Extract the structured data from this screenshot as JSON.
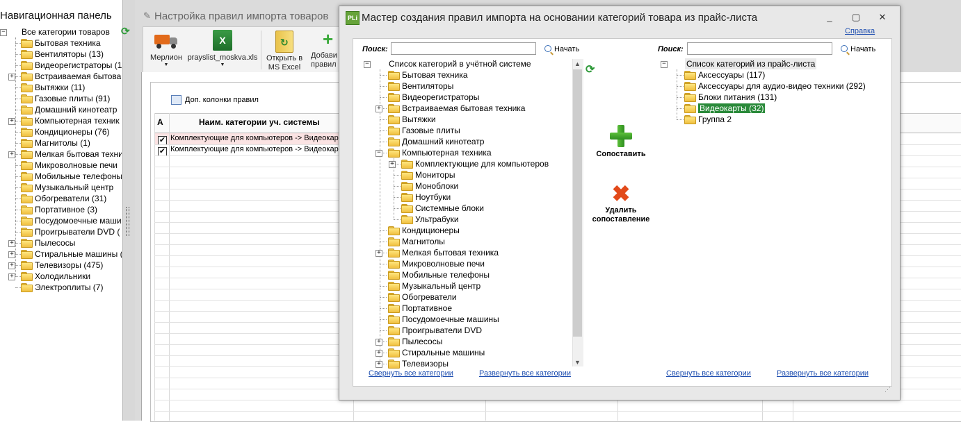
{
  "nav": {
    "title": "Навигационная панель",
    "root": "Все категории товаров",
    "items": [
      {
        "label": "Бытовая техника",
        "expandable": false
      },
      {
        "label": "Вентиляторы (13)",
        "expandable": false
      },
      {
        "label": "Видеорегистраторы (1",
        "expandable": false
      },
      {
        "label": "Встраиваемая бытова",
        "expandable": true
      },
      {
        "label": "Вытяжки (11)",
        "expandable": false
      },
      {
        "label": "Газовые плиты (91)",
        "expandable": false
      },
      {
        "label": "Домашний кинотеатр",
        "expandable": false
      },
      {
        "label": "Компьютерная техник",
        "expandable": true
      },
      {
        "label": "Кондиционеры (76)",
        "expandable": false
      },
      {
        "label": "Магнитолы (1)",
        "expandable": false
      },
      {
        "label": "Мелкая бытовая техни",
        "expandable": true
      },
      {
        "label": "Микроволновые печи",
        "expandable": false
      },
      {
        "label": "Мобильные телефоны",
        "expandable": false
      },
      {
        "label": "Музыкальный центр",
        "expandable": false
      },
      {
        "label": "Обогреватели (31)",
        "expandable": false
      },
      {
        "label": "Портативное (3)",
        "expandable": false
      },
      {
        "label": "Посудомоечные маши",
        "expandable": false
      },
      {
        "label": "Проигрыватели DVD (",
        "expandable": false
      },
      {
        "label": "Пылесосы",
        "expandable": true
      },
      {
        "label": "Стиральные машины (",
        "expandable": true
      },
      {
        "label": "Телевизоры (475)",
        "expandable": true
      },
      {
        "label": "Холодильники",
        "expandable": true
      },
      {
        "label": "Электроплиты (7)",
        "expandable": false
      }
    ]
  },
  "bgwin": {
    "title": "Настройка правил импорта товаров",
    "ribbon": {
      "merlion": "Мерлион",
      "file": "prayslist_moskva.xls",
      "open_excel_1": "Открыть в",
      "open_excel_2": "MS Excel",
      "add_rule_1": "Добави",
      "add_rule_2": "правил"
    },
    "extra_cols": "Доп. колонки правил",
    "grid": {
      "col_a": "А",
      "col_name": "Наим. категории уч. системы",
      "rows": [
        "Комплектующие для компьютеров -> Видеокар",
        "Комплектующие для компьютеров -> Видеокар"
      ]
    }
  },
  "dialog": {
    "title": "Мастер создания правил импорта на основании категорий товара из прайс-листа",
    "help": "Справка",
    "search_label": "Поиск:",
    "search_button": "Начать",
    "left_search_value": "",
    "right_search_value": "",
    "left_root": "Список категорий в учётной системе",
    "left_items": [
      {
        "label": "Бытовая техника",
        "level": 1,
        "expandable": false
      },
      {
        "label": "Вентиляторы",
        "level": 1,
        "expandable": false
      },
      {
        "label": "Видеорегистраторы",
        "level": 1,
        "expandable": false
      },
      {
        "label": "Встраиваемая бытовая техника",
        "level": 1,
        "expandable": true
      },
      {
        "label": "Вытяжки",
        "level": 1,
        "expandable": false
      },
      {
        "label": "Газовые плиты",
        "level": 1,
        "expandable": false
      },
      {
        "label": "Домашний кинотеатр",
        "level": 1,
        "expandable": false
      },
      {
        "label": "Компьютерная техника",
        "level": 1,
        "expandable": true,
        "expanded": true
      },
      {
        "label": "Комплектующие для компьютеров",
        "level": 2,
        "expandable": true
      },
      {
        "label": "Мониторы",
        "level": 2,
        "expandable": false
      },
      {
        "label": "Моноблоки",
        "level": 2,
        "expandable": false
      },
      {
        "label": "Ноутбуки",
        "level": 2,
        "expandable": false
      },
      {
        "label": "Системные блоки",
        "level": 2,
        "expandable": false
      },
      {
        "label": "Ультрабуки",
        "level": 2,
        "expandable": false
      },
      {
        "label": "Кондиционеры",
        "level": 1,
        "expandable": false
      },
      {
        "label": "Магнитолы",
        "level": 1,
        "expandable": false
      },
      {
        "label": "Мелкая бытовая техника",
        "level": 1,
        "expandable": true
      },
      {
        "label": "Микроволновые печи",
        "level": 1,
        "expandable": false
      },
      {
        "label": "Мобильные телефоны",
        "level": 1,
        "expandable": false
      },
      {
        "label": "Музыкальный центр",
        "level": 1,
        "expandable": false
      },
      {
        "label": "Обогреватели",
        "level": 1,
        "expandable": false
      },
      {
        "label": "Портативное",
        "level": 1,
        "expandable": false
      },
      {
        "label": "Посудомоечные машины",
        "level": 1,
        "expandable": false
      },
      {
        "label": "Проигрыватели DVD",
        "level": 1,
        "expandable": false
      },
      {
        "label": "Пылесосы",
        "level": 1,
        "expandable": true
      },
      {
        "label": "Стиральные машины",
        "level": 1,
        "expandable": true
      },
      {
        "label": "Телевизоры",
        "level": 1,
        "expandable": true
      }
    ],
    "right_root": "Список категорий из прайс-листа",
    "right_items": [
      {
        "label": "Аксессуары (117)",
        "selected": false
      },
      {
        "label": "Аксессуары для аудио-видео техники (292)",
        "selected": false
      },
      {
        "label": "Блоки питания (131)",
        "selected": false
      },
      {
        "label": "Видеокарты (32)",
        "selected": true
      },
      {
        "label": "Группа 2",
        "selected": false
      }
    ],
    "match_button": "Сопоставить",
    "delete_button_1": "Удалить",
    "delete_button_2": "сопоставление",
    "collapse_all": "Свернуть все категории",
    "expand_all": "Развернуть все категории"
  }
}
